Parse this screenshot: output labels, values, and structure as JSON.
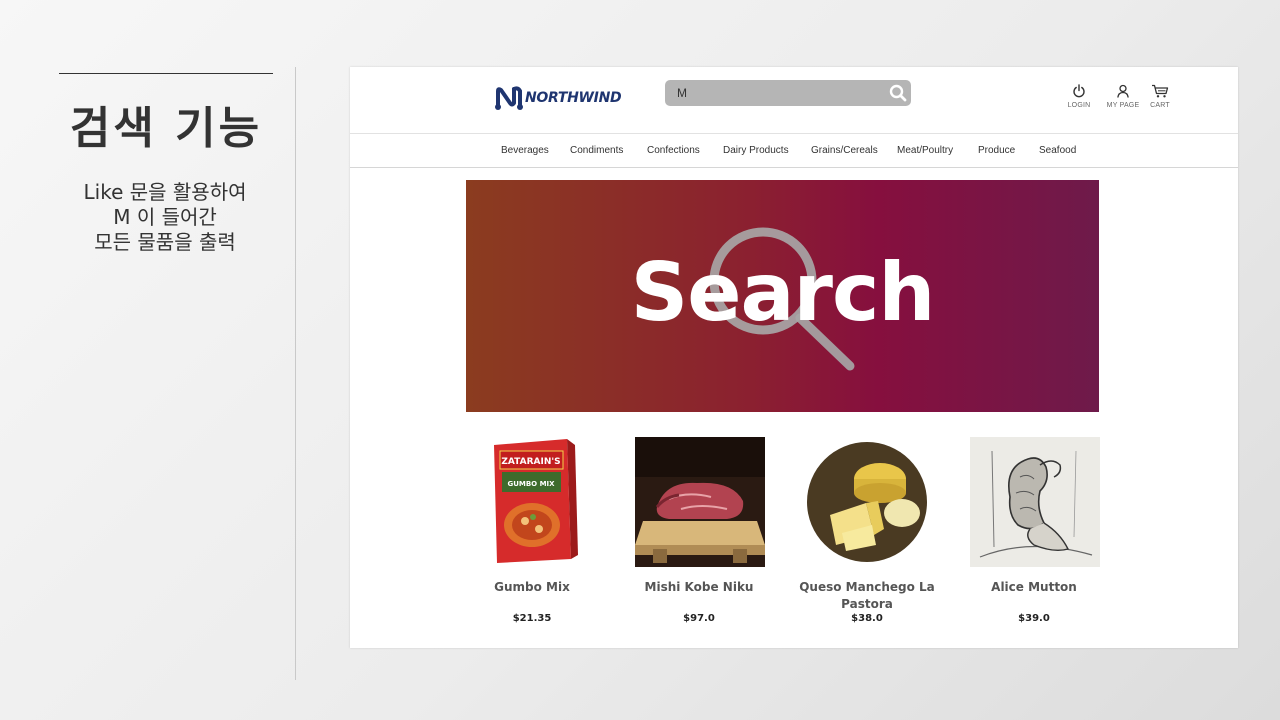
{
  "slide": {
    "title": "검색 기능",
    "description": [
      "Like 문을 활용하여",
      "M 이 들어간",
      "모든 물품을 출력"
    ]
  },
  "site": {
    "logo_text": "NORTHWIND",
    "search": {
      "value": "M",
      "icon": "search-icon"
    },
    "utilities": [
      {
        "label": "LOGIN",
        "icon": "power-icon"
      },
      {
        "label": "MY PAGE",
        "icon": "user-icon"
      },
      {
        "label": "CART",
        "icon": "cart-icon"
      }
    ],
    "categories": [
      "Beverages",
      "Condiments",
      "Confections",
      "Dairy Products",
      "Grains/Cereals",
      "Meat/Poultry",
      "Produce",
      "Seafood"
    ],
    "banner": {
      "text": "Search",
      "icon": "magnifier-icon"
    },
    "products": [
      {
        "name": "Gumbo Mix",
        "price": "$21.35",
        "image": "gumbo-mix-box"
      },
      {
        "name": "Mishi Kobe Niku",
        "price": "$97.0",
        "image": "kobe-beef"
      },
      {
        "name": "Queso Manchego La Pastora",
        "price": "$38.0",
        "image": "manchego-cheese"
      },
      {
        "name": "Alice Mutton",
        "price": "$39.0",
        "image": "mutton-illustration"
      }
    ],
    "colors": {
      "brand": "#1f3570",
      "banner_start": "#8b3c1f",
      "banner_end": "#6e1a4a"
    }
  }
}
